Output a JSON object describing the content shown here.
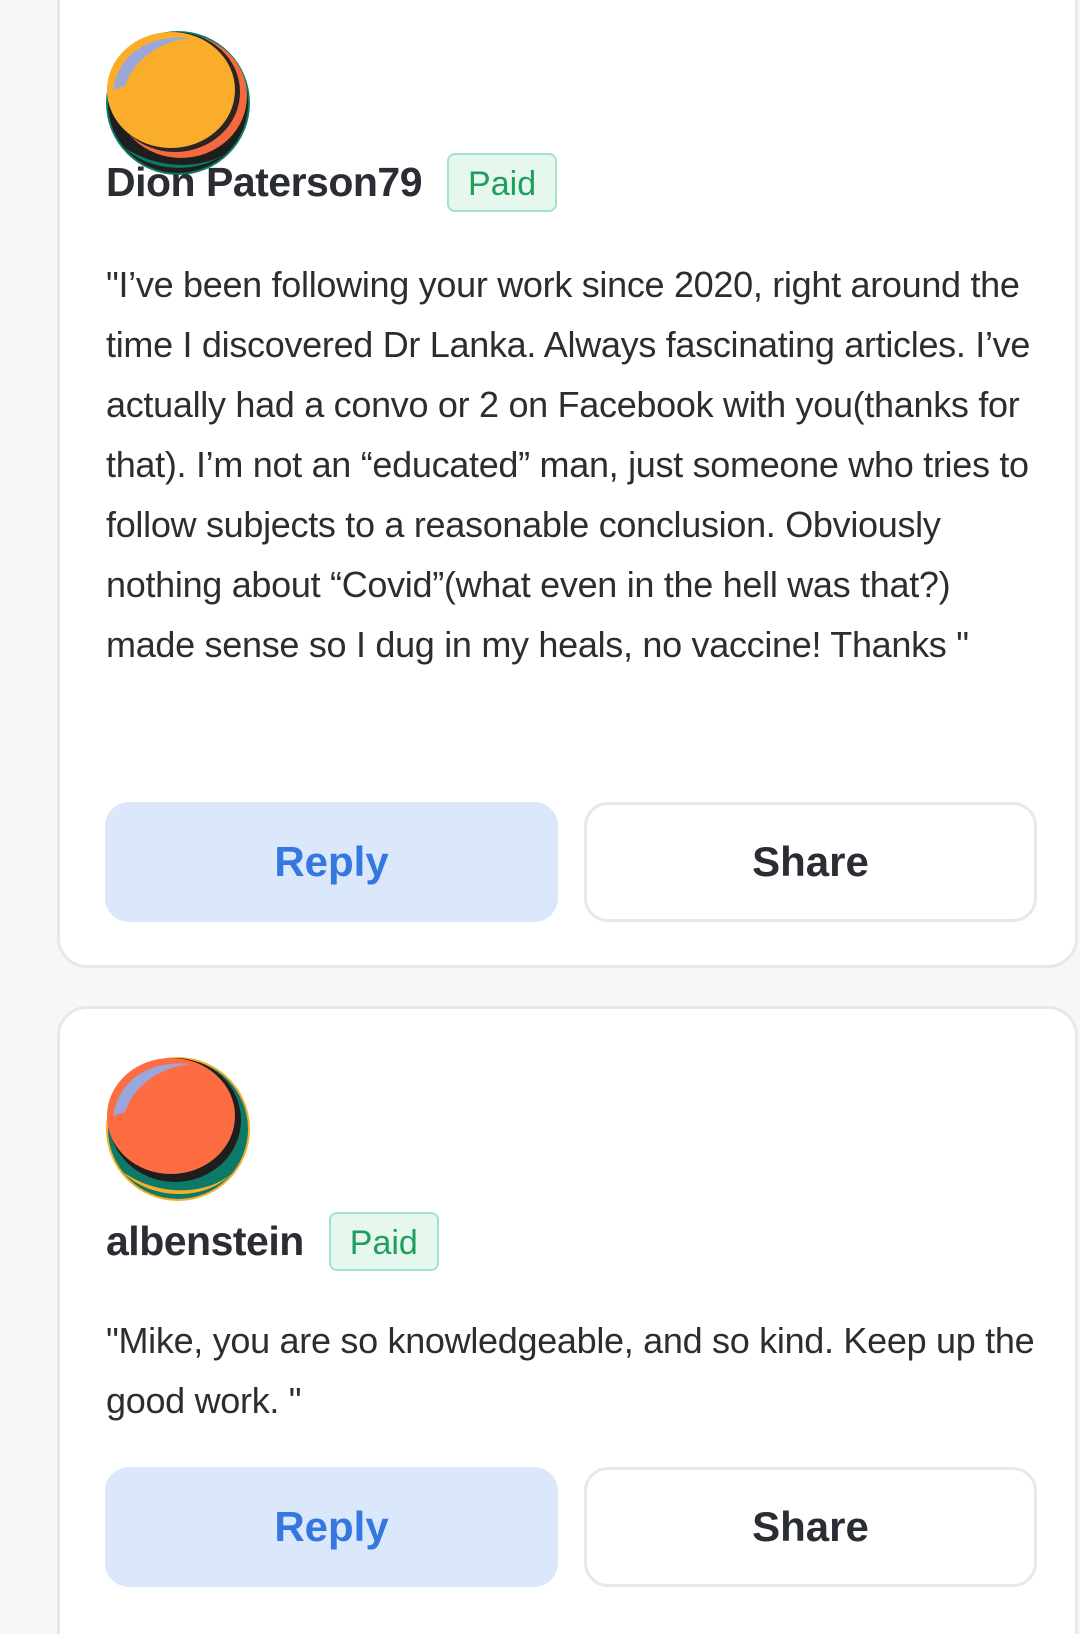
{
  "comments": [
    {
      "author": "Dion Paterson79",
      "badge": "Paid",
      "text": "\"I’ve been following your work since 2020, right around the time I discovered Dr Lanka. Always fascinating articles. I’ve actually had a convo or 2 on Facebook with you(thanks for that). I’m not an “educated” man, just someone who tries to follow subjects to a reasonable conclusion. Obviously nothing about “Covid”(what even in the hell was that?) made sense so I dug in my heals, no vaccine! Thanks \"",
      "reply_label": "Reply",
      "share_label": "Share",
      "avatar": {
        "icon": "avatar-icon",
        "main_color": "#f9ad2a",
        "accent_color": "#f26a3d",
        "bottom_color": "#0c7a66"
      }
    },
    {
      "author": "albenstein",
      "badge": "Paid",
      "text": "\"Mike, you are so knowledgeable, and so kind. Keep up the good work. \"",
      "reply_label": "Reply",
      "share_label": "Share",
      "avatar": {
        "icon": "avatar-icon",
        "main_color": "#fe6c42",
        "accent_color": "#0c7a66",
        "bottom_color": "#f9ad2a"
      }
    }
  ],
  "colors": {
    "paid_badge_bg": "#e6f7ee",
    "paid_badge_text": "#1f9e5e",
    "reply_bg": "#dbe7fb",
    "reply_text": "#3477e0"
  }
}
